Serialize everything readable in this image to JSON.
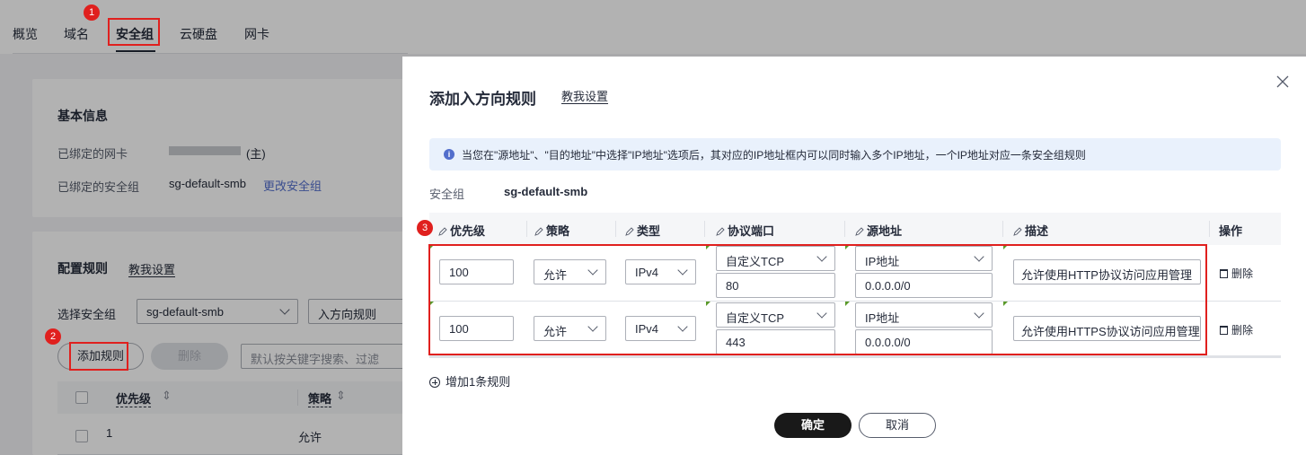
{
  "tabs": [
    "概览",
    "域名",
    "安全组",
    "云硬盘",
    "网卡"
  ],
  "basic_info": {
    "title": "基本信息",
    "nic_label": "已绑定的网卡",
    "nic_value": "(主)",
    "sg_label": "已绑定的安全组",
    "sg_value": "sg-default-smb",
    "change_sg_link": "更改安全组"
  },
  "rules": {
    "title": "配置规则",
    "help_link": "教我设置",
    "select_sg_label": "选择安全组",
    "select_sg_value": "sg-default-smb",
    "direction_value": "入方向规则",
    "add_button": "添加规则",
    "delete_button": "删除",
    "search_placeholder": "默认按关键字搜索、过滤",
    "columns": [
      "优先级",
      "策略"
    ],
    "rows": [
      {
        "priority": "1",
        "policy": "允许"
      }
    ]
  },
  "annotations": {
    "badge1": "1",
    "badge2": "2",
    "badge3": "3"
  },
  "modal": {
    "title": "添加入方向规则",
    "help_link": "教我设置",
    "notice": "当您在\"源地址\"、\"目的地址\"中选择\"IP地址\"选项后，其对应的IP地址框内可以同时输入多个IP地址，一个IP地址对应一条安全组规则",
    "sg_label": "安全组",
    "sg_value": "sg-default-smb",
    "columns": [
      "优先级",
      "策略",
      "类型",
      "协议端口",
      "源地址",
      "描述",
      "操作"
    ],
    "rows": [
      {
        "priority": "100",
        "policy": "允许",
        "type": "IPv4",
        "protocol": "自定义TCP",
        "port": "80",
        "source_type": "IP地址",
        "source": "0.0.0.0/0",
        "description": "允许使用HTTP协议访问应用管理",
        "action": "删除"
      },
      {
        "priority": "100",
        "policy": "允许",
        "type": "IPv4",
        "protocol": "自定义TCP",
        "port": "443",
        "source_type": "IP地址",
        "source": "0.0.0.0/0",
        "description": "允许使用HTTPS协议访问应用管理",
        "action": "删除"
      }
    ],
    "add_rule": "增加1条规则",
    "confirm": "确定",
    "cancel": "取消"
  }
}
